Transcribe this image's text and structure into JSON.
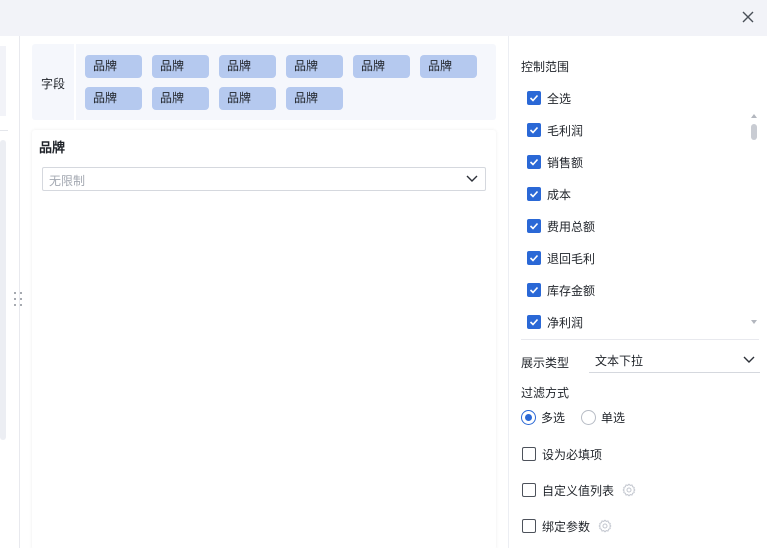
{
  "dialog": {
    "close_icon": "close-icon"
  },
  "fields": {
    "label": "字段",
    "chips": [
      "品牌",
      "品牌",
      "品牌",
      "品牌",
      "品牌",
      "品牌",
      "品牌",
      "品牌",
      "品牌",
      "品牌"
    ]
  },
  "filter": {
    "title": "品牌",
    "placeholder": "无限制"
  },
  "control_range": {
    "title": "控制范围",
    "items": [
      {
        "label": "全选",
        "checked": true
      },
      {
        "label": "毛利润",
        "checked": true
      },
      {
        "label": "销售额",
        "checked": true
      },
      {
        "label": "成本",
        "checked": true
      },
      {
        "label": "费用总额",
        "checked": true
      },
      {
        "label": "退回毛利",
        "checked": true
      },
      {
        "label": "库存金额",
        "checked": true
      },
      {
        "label": "净利润",
        "checked": true
      }
    ]
  },
  "display": {
    "label": "展示类型",
    "value": "文本下拉"
  },
  "filter_mode": {
    "label": "过滤方式",
    "options": [
      {
        "label": "多选",
        "selected": true
      },
      {
        "label": "单选",
        "selected": false
      }
    ]
  },
  "options": {
    "required_label": "设为必填项",
    "custom_list_label": "自定义值列表",
    "bind_param_label": "绑定参数"
  },
  "colors": {
    "accent": "#2a68d6",
    "chip": "#b5c9ef",
    "topbar": "#f2f3f8"
  }
}
